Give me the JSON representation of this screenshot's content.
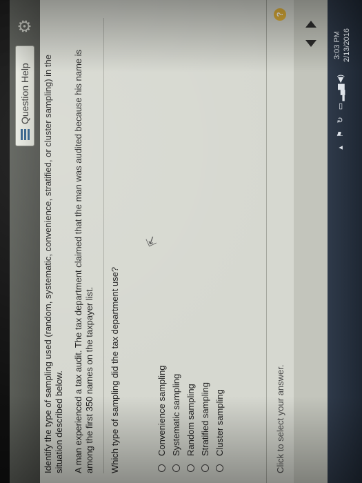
{
  "header": {
    "help_button_label": "Question Help",
    "settings_icon": "gear-icon"
  },
  "question": {
    "instruction": "Identify the type of sampling used (random, systematic, convenience, stratified, or cluster sampling) in the situation described below.",
    "scenario": "A man experienced a tax audit. The tax department claimed that the man was audited because his name is among the first 350 names on the taxpayer list.",
    "prompt": "Which type of sampling did the tax department use?"
  },
  "options": [
    {
      "label": "Convenience sampling",
      "selected": false
    },
    {
      "label": "Systematic sampling",
      "selected": false
    },
    {
      "label": "Random sampling",
      "selected": false
    },
    {
      "label": "Stratified sampling",
      "selected": false
    },
    {
      "label": "Cluster sampling",
      "selected": false
    }
  ],
  "footer": {
    "hint": "Click to select your answer.",
    "help_symbol": "?"
  },
  "taskbar": {
    "time": "3:03 PM",
    "date": "2/13/2016"
  },
  "colors": {
    "page_background": "#d6d8d0",
    "header_bar": "#4a4c47",
    "help_badge": "#e3b33a",
    "taskbar": "#1e2733"
  }
}
